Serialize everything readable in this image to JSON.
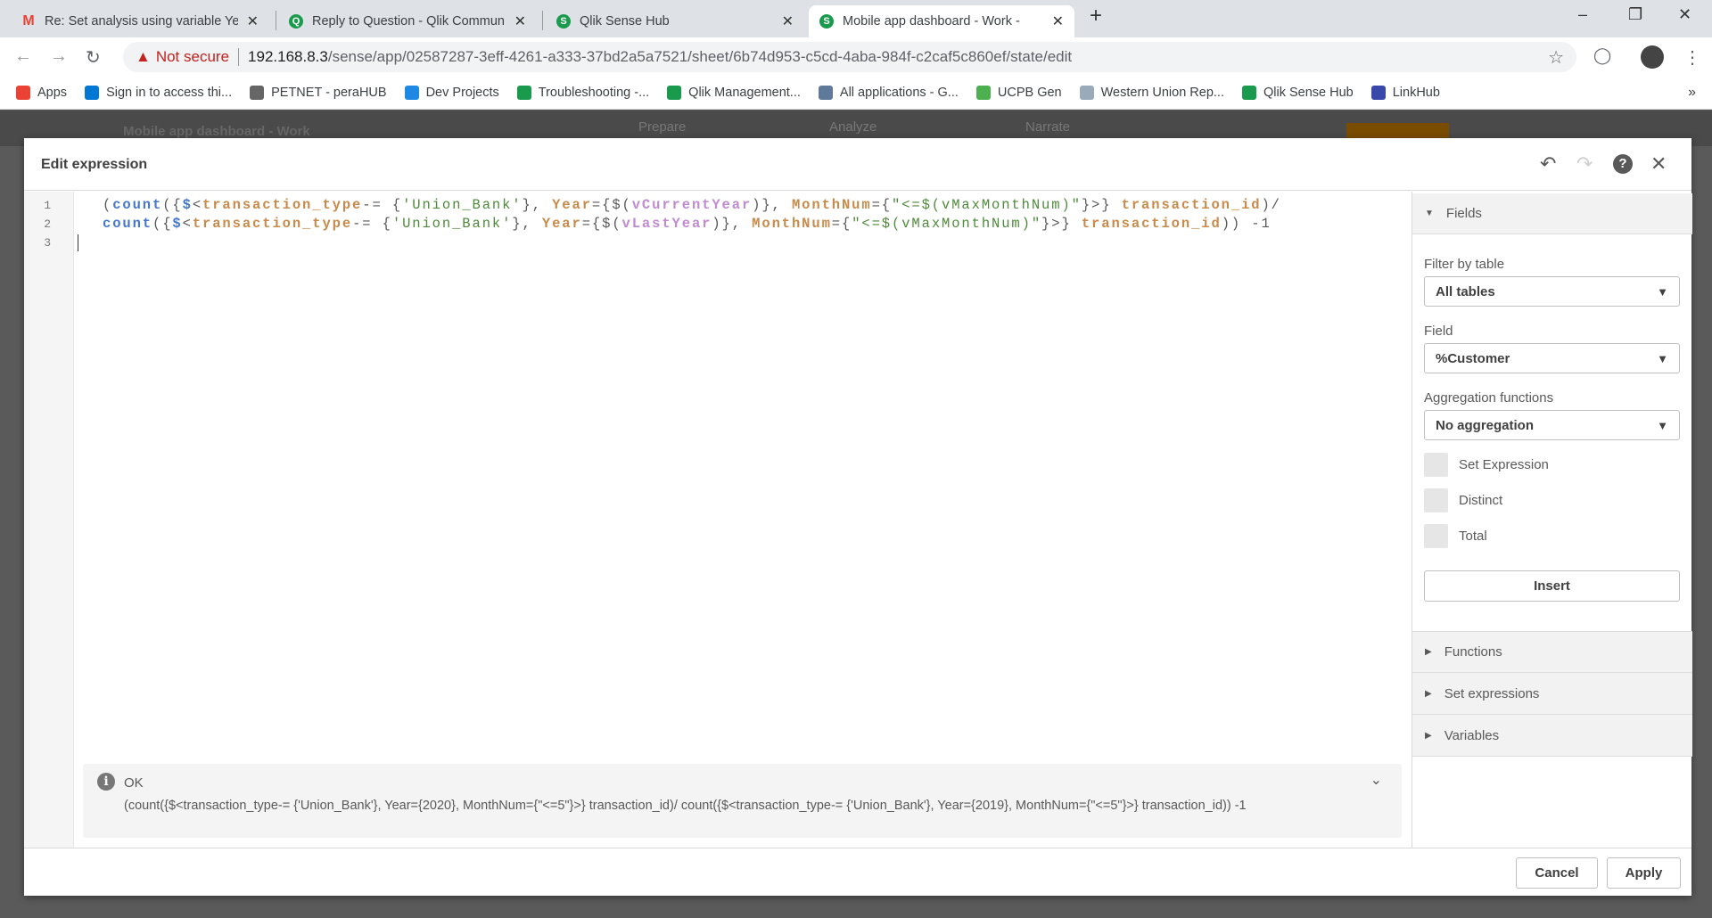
{
  "browser": {
    "tabs": [
      {
        "title": "Re: Set analysis using variable Ye",
        "icon": "gmail-icon"
      },
      {
        "title": "Reply to Question - Qlik Commun",
        "icon": "qlik-community-icon"
      },
      {
        "title": "Qlik Sense Hub",
        "icon": "qlik-sense-icon"
      },
      {
        "title": "Mobile app dashboard - Work - ",
        "icon": "qlik-sense-icon"
      }
    ],
    "not_secure": "Not secure",
    "url_host": "192.168.8.3",
    "url_path": "/sense/app/02587287-3eff-4261-a333-37bd2a5a7521/sheet/6b74d953-c5cd-4aba-984f-c2caf5c860ef/state/edit",
    "bookmarks": [
      {
        "label": "Apps",
        "color": "#ea4335"
      },
      {
        "label": "Sign in to access thi...",
        "color": "#0078d4"
      },
      {
        "label": "PETNET - peraHUB",
        "color": "#666666"
      },
      {
        "label": "Dev Projects",
        "color": "#1e88e5"
      },
      {
        "label": "Troubleshooting -...",
        "color": "#1a9a4c"
      },
      {
        "label": "Qlik Management...",
        "color": "#1a9a4c"
      },
      {
        "label": "All applications - G...",
        "color": "#5f7a99"
      },
      {
        "label": "UCPB Gen",
        "color": "#4caf50"
      },
      {
        "label": "Western Union Rep...",
        "color": "#9ab"
      },
      {
        "label": "Qlik Sense Hub",
        "color": "#1a9a4c"
      },
      {
        "label": "LinkHub",
        "color": "#3949ab"
      }
    ]
  },
  "app": {
    "title": "Mobile app dashboard - Work",
    "tabs": [
      "Prepare",
      "Analyze",
      "Narrate"
    ]
  },
  "dialog": {
    "title": "Edit expression",
    "line_numbers": [
      "1",
      "2",
      "3"
    ],
    "code_lines": [
      [
        [
          "p",
          "("
        ],
        [
          "fn",
          "count"
        ],
        [
          "p",
          "({"
        ],
        [
          "dol",
          "$"
        ],
        [
          "p",
          "<"
        ],
        [
          "fld",
          "transaction_type"
        ],
        [
          "p",
          "-= {"
        ],
        [
          "str",
          "'Union_Bank'"
        ],
        [
          "p",
          "}, "
        ],
        [
          "fld",
          "Year"
        ],
        [
          "p",
          "={$("
        ],
        [
          "var",
          "vCurrentYear"
        ],
        [
          "p",
          ")}, "
        ],
        [
          "fld",
          "MonthNum"
        ],
        [
          "p",
          "={"
        ],
        [
          "str",
          "\"<=$(vMaxMonthNum)\""
        ],
        [
          "p",
          "}>} "
        ],
        [
          "fld",
          "transaction_id"
        ],
        [
          "p",
          ")/"
        ]
      ],
      [
        [
          "fn",
          "count"
        ],
        [
          "p",
          "({"
        ],
        [
          "dol",
          "$"
        ],
        [
          "p",
          "<"
        ],
        [
          "fld",
          "transaction_type"
        ],
        [
          "p",
          "-= {"
        ],
        [
          "str",
          "'Union_Bank'"
        ],
        [
          "p",
          "}, "
        ],
        [
          "fld",
          "Year"
        ],
        [
          "p",
          "={$("
        ],
        [
          "var",
          "vLastYear"
        ],
        [
          "p",
          ")}, "
        ],
        [
          "fld",
          "MonthNum"
        ],
        [
          "p",
          "={"
        ],
        [
          "str",
          "\"<=$(vMaxMonthNum)\""
        ],
        [
          "p",
          "}>} "
        ],
        [
          "fld",
          "transaction_id"
        ],
        [
          "p",
          ")) -1"
        ]
      ],
      []
    ],
    "status": {
      "state": "OK",
      "result": "(count({$<transaction_type-= {'Union_Bank'}, Year={2020}, MonthNum={\"<=5\"}>} transaction_id)/ count({$<transaction_type-= {'Union_Bank'}, Year={2019}, MonthNum={\"<=5\"}>} transaction_id)) -1"
    },
    "panel": {
      "fields_header": "Fields",
      "filter_label": "Filter by table",
      "filter_value": "All tables",
      "field_label": "Field",
      "field_value": "%Customer",
      "agg_label": "Aggregation functions",
      "agg_value": "No aggregation",
      "checkboxes": [
        "Set Expression",
        "Distinct",
        "Total"
      ],
      "insert": "Insert",
      "sections": [
        "Functions",
        "Set expressions",
        "Variables"
      ]
    },
    "cancel": "Cancel",
    "apply": "Apply"
  }
}
